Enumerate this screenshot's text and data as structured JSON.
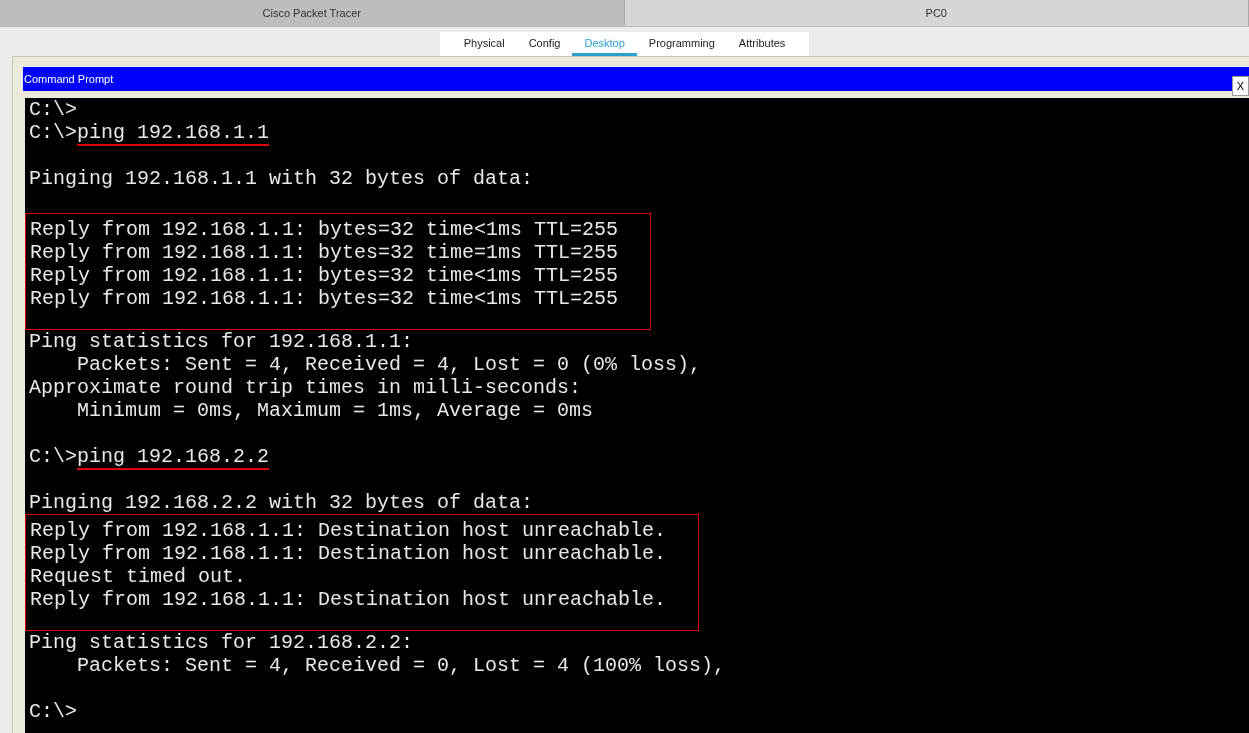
{
  "window_tabs": [
    {
      "label": "Cisco Packet Tracer",
      "selected": false
    },
    {
      "label": "PC0",
      "selected": true
    }
  ],
  "tabs": [
    {
      "label": "Physical",
      "selected": false
    },
    {
      "label": "Config",
      "selected": false
    },
    {
      "label": "Desktop",
      "selected": true
    },
    {
      "label": "Programming",
      "selected": false
    },
    {
      "label": "Attributes",
      "selected": false
    }
  ],
  "command_prompt": {
    "title": "Command Prompt",
    "close": "X",
    "blocks": [
      {
        "kind": "line",
        "text": "C:\\>"
      },
      {
        "kind": "command",
        "prompt": "C:\\>",
        "command": "ping 192.168.1.1",
        "underlined": true
      },
      {
        "kind": "blank"
      },
      {
        "kind": "line",
        "text": "Pinging 192.168.1.1 with 32 bytes of data:"
      },
      {
        "kind": "blank"
      },
      {
        "kind": "box",
        "lines": [
          "Reply from 192.168.1.1: bytes=32 time<1ms TTL=255",
          "Reply from 192.168.1.1: bytes=32 time=1ms TTL=255",
          "Reply from 192.168.1.1: bytes=32 time<1ms TTL=255",
          "Reply from 192.168.1.1: bytes=32 time<1ms TTL=255"
        ]
      },
      {
        "kind": "line",
        "text": "Ping statistics for 192.168.1.1:"
      },
      {
        "kind": "line",
        "text": "    Packets: Sent = 4, Received = 4, Lost = 0 (0% loss),"
      },
      {
        "kind": "line",
        "text": "Approximate round trip times in milli-seconds:"
      },
      {
        "kind": "line",
        "text": "    Minimum = 0ms, Maximum = 1ms, Average = 0ms"
      },
      {
        "kind": "blank"
      },
      {
        "kind": "command",
        "prompt": "C:\\>",
        "command": "ping 192.168.2.2",
        "underlined": true
      },
      {
        "kind": "blank"
      },
      {
        "kind": "line",
        "text": "Pinging 192.168.2.2 with 32 bytes of data:"
      },
      {
        "kind": "box",
        "lines": [
          "Reply from 192.168.1.1: Destination host unreachable.",
          "Reply from 192.168.1.1: Destination host unreachable.",
          "Request timed out.",
          "Reply from 192.168.1.1: Destination host unreachable."
        ]
      },
      {
        "kind": "line",
        "text": "Ping statistics for 192.168.2.2:"
      },
      {
        "kind": "line",
        "text": "    Packets: Sent = 4, Received = 0, Lost = 4 (100% loss),"
      },
      {
        "kind": "blank"
      },
      {
        "kind": "line",
        "text": "C:\\>"
      }
    ]
  }
}
